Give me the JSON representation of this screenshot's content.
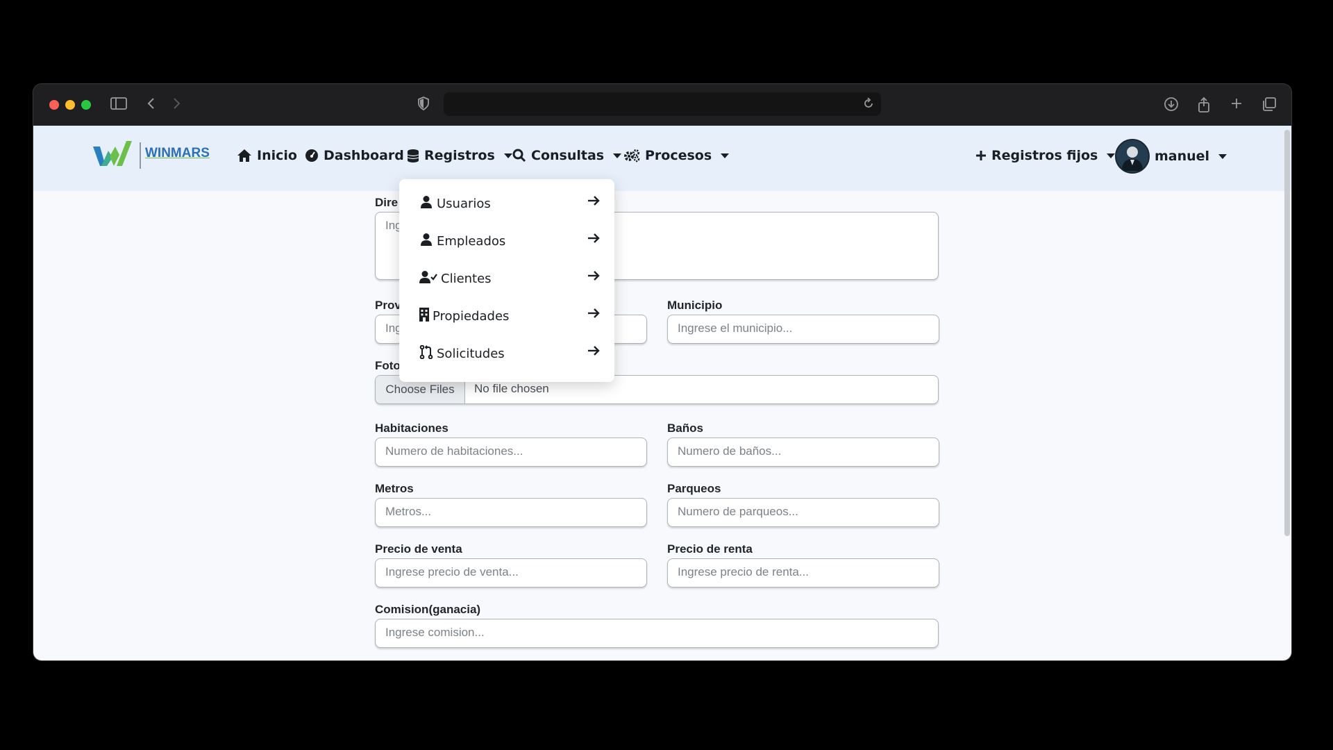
{
  "navbar": {
    "brand": "WINMARS",
    "items": [
      {
        "label": "Inicio",
        "icon": "home-icon"
      },
      {
        "label": "Dashboard",
        "icon": "dashboard-icon"
      },
      {
        "label": "Registros",
        "icon": "database-icon"
      },
      {
        "label": "Consultas",
        "icon": "search-icon"
      },
      {
        "label": "Procesos",
        "icon": "gears-icon"
      }
    ],
    "registros_fijos": "Registros fijos",
    "user": "manuel"
  },
  "dropdown": {
    "items": [
      {
        "label": "Usuarios",
        "icon": "user-icon"
      },
      {
        "label": "Empleados",
        "icon": "user-icon"
      },
      {
        "label": "Clientes",
        "icon": "user-check-icon"
      },
      {
        "label": "Propiedades",
        "icon": "building-icon"
      },
      {
        "label": "Solicitudes",
        "icon": "pull-request-icon"
      }
    ]
  },
  "form": {
    "direccion": {
      "label": "Dire",
      "placeholder": "Ing"
    },
    "provincia": {
      "label": "Prov",
      "placeholder": "Ing"
    },
    "municipio": {
      "label": "Municipio",
      "placeholder": "Ingrese el municipio..."
    },
    "foto": {
      "label": "Foto",
      "button": "Choose Files",
      "status": "No file chosen"
    },
    "habitaciones": {
      "label": "Habitaciones",
      "placeholder": "Numero de habitaciones..."
    },
    "banos": {
      "label": "Baños",
      "placeholder": "Numero de baños..."
    },
    "metros": {
      "label": "Metros",
      "placeholder": "Metros..."
    },
    "parqueos": {
      "label": "Parqueos",
      "placeholder": "Numero de parqueos..."
    },
    "precio_venta": {
      "label": "Precio de venta",
      "placeholder": "Ingrese precio de venta..."
    },
    "precio_renta": {
      "label": "Precio de renta",
      "placeholder": "Ingrese precio de renta..."
    },
    "comision": {
      "label": "Comision(ganacia)",
      "placeholder": "Ingrese comision..."
    }
  },
  "colors": {
    "navbar_bg": "#e7f0fa",
    "page_bg": "#f7f9fc",
    "logo_green": "#6cc04a",
    "logo_blue": "#2a7fc1"
  }
}
